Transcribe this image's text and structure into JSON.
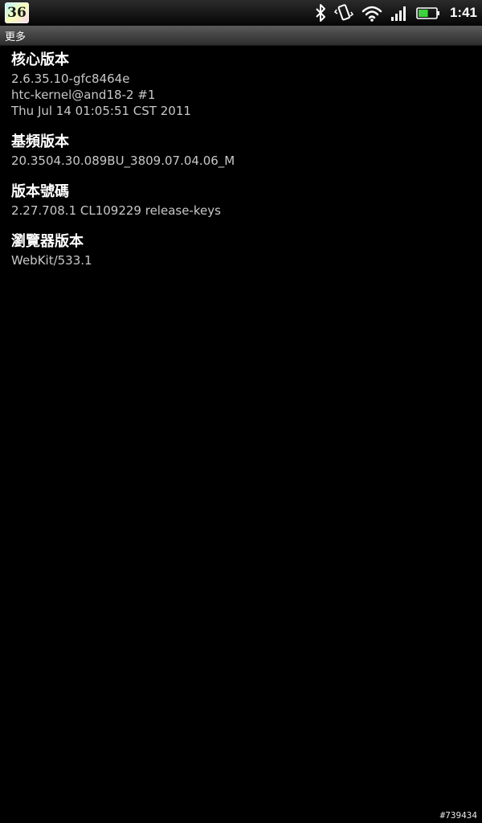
{
  "status_bar": {
    "notification_app_label": "36",
    "icons": [
      "bluetooth-icon",
      "vibrate-icon",
      "wifi-icon",
      "signal-icon",
      "battery-icon"
    ],
    "clock": "1:41",
    "battery_fill": 0.55,
    "accent_battery": "#3cd43c"
  },
  "title_bar": {
    "title": "更多"
  },
  "items": [
    {
      "title": "核心版本",
      "lines": [
        "2.6.35.10-gfc8464e",
        "htc-kernel@and18-2 #1",
        "Thu Jul 14 01:05:51 CST 2011"
      ]
    },
    {
      "title": "基頻版本",
      "lines": [
        "20.3504.30.089BU_3809.07.04.06_M"
      ]
    },
    {
      "title": "版本號碼",
      "lines": [
        "2.27.708.1 CL109229 release-keys"
      ]
    },
    {
      "title": "瀏覽器版本",
      "lines": [
        "WebKit/533.1"
      ]
    }
  ],
  "watermark": "#739434"
}
